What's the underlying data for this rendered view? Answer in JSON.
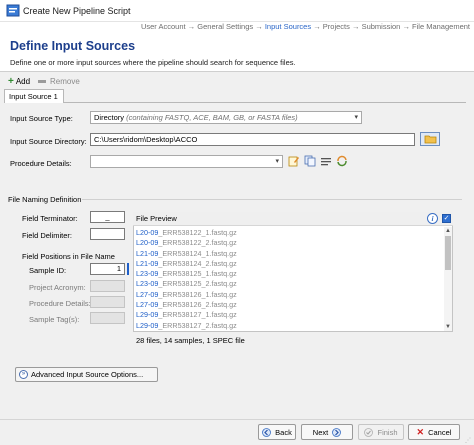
{
  "window": {
    "title": "Create New Pipeline Script"
  },
  "breadcrumb": {
    "items": [
      "User Account",
      "General Settings",
      "Input Sources",
      "Projects",
      "Submission",
      "File Management"
    ],
    "separator": "→",
    "active_index": 2
  },
  "header": {
    "title": "Define Input Sources",
    "description": "Define one or more input sources where the pipeline should search for sequence files."
  },
  "toolbar": {
    "add_label": "Add",
    "remove_label": "Remove"
  },
  "tabs": [
    {
      "label": "Input Source 1",
      "selected": true
    }
  ],
  "form": {
    "source_type_label": "Input Source Type:",
    "source_type_value": "Directory",
    "source_type_hint": "(containing FASTQ, ACE, BAM, GB, or FASTA files)",
    "directory_label": "Input Source Directory:",
    "directory_value": "C:\\Users\\ridom\\Desktop\\ACCO",
    "procedure_label": "Procedure Details:",
    "procedure_value": ""
  },
  "file_naming": {
    "group_title": "File Naming Definition",
    "field_terminator_label": "Field Terminator:",
    "field_terminator_value": "_",
    "field_delimiter_label": "Field Delimiter:",
    "field_delimiter_value": "",
    "positions_label": "Field Positions in File Name",
    "sample_id_label": "Sample ID:",
    "sample_id_value": "1",
    "project_acronym_label": "Project Acronym:",
    "procedure_details_label": "Procedure Details:",
    "sample_tags_label": "Sample Tag(s):"
  },
  "preview": {
    "title": "File Preview",
    "files": [
      {
        "highlight": "L20-09",
        "rest": "_ERR538122_1.fastq.gz"
      },
      {
        "highlight": "L20-09",
        "rest": "_ERR538122_2.fastq.gz"
      },
      {
        "highlight": "L21-09",
        "rest": "_ERR538124_1.fastq.gz"
      },
      {
        "highlight": "L21-09",
        "rest": "_ERR538124_2.fastq.gz"
      },
      {
        "highlight": "L23-09",
        "rest": "_ERR538125_1.fastq.gz"
      },
      {
        "highlight": "L23-09",
        "rest": "_ERR538125_2.fastq.gz"
      },
      {
        "highlight": "L27-09",
        "rest": "_ERR538126_1.fastq.gz"
      },
      {
        "highlight": "L27-09",
        "rest": "_ERR538126_2.fastq.gz"
      },
      {
        "highlight": "L29-09",
        "rest": "_ERR538127_1.fastq.gz"
      },
      {
        "highlight": "L29-09",
        "rest": "_ERR538127_2.fastq.gz"
      }
    ],
    "summary": "28 files, 14 samples, 1 SPEC file"
  },
  "advanced_button": "Advanced Input Source Options...",
  "footer": {
    "back": "Back",
    "next": "Next",
    "finish": "Finish",
    "cancel": "Cancel"
  },
  "colors": {
    "accent": "#1d3f8c",
    "highlight": "#1f5fc8",
    "active_crumb": "#2a66c8"
  }
}
